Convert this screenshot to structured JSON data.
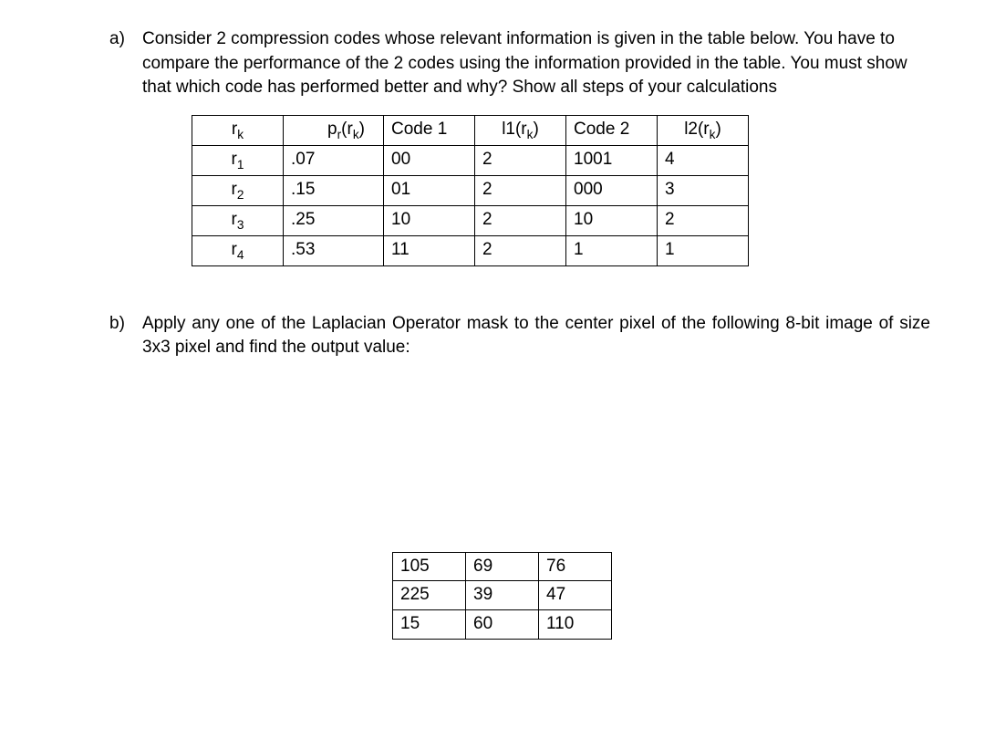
{
  "qa": {
    "label": "a)",
    "text": "Consider 2 compression codes whose relevant information is given in the table below. You have to compare the performance of the 2 codes using the information provided in the table. You must show that which code has performed better and why? Show all steps of your calculations"
  },
  "codes_table": {
    "headers": {
      "rk": "r",
      "rk_sub": "k",
      "pr": "p",
      "pr_sub": "r",
      "pr_arg": "(r",
      "pr_arg_sub": "k",
      "pr_close": ")",
      "code1": "Code 1",
      "l1": "l1(r",
      "l1_sub": "k",
      "l1_close": ")",
      "code2": "Code 2",
      "l2": "l2(r",
      "l2_sub": "k",
      "l2_close": ")"
    },
    "rows": [
      {
        "rk": "r",
        "rk_sub": "1",
        "pr": ".07",
        "c1": "00",
        "l1": "2",
        "c2": "1001",
        "l2": "4"
      },
      {
        "rk": "r",
        "rk_sub": "2",
        "pr": ".15",
        "c1": "01",
        "l1": "2",
        "c2": "000",
        "l2": "3"
      },
      {
        "rk": "r",
        "rk_sub": "3",
        "pr": ".25",
        "c1": "10",
        "l1": "2",
        "c2": "10",
        "l2": "2"
      },
      {
        "rk": "r",
        "rk_sub": "4",
        "pr": ".53",
        "c1": "11",
        "l1": "2",
        "c2": "1",
        "l2": "1"
      }
    ]
  },
  "qb": {
    "label": "b)",
    "text": "Apply any one of the Laplacian Operator mask to the center pixel of the following 8-bit image of size 3x3 pixel and find the output value:"
  },
  "image_matrix": [
    [
      "105",
      "69",
      "76"
    ],
    [
      "225",
      "39",
      "47"
    ],
    [
      "15",
      "60",
      "110"
    ]
  ],
  "chart_data": [
    {
      "type": "table",
      "title": "Compression codes comparison",
      "columns": [
        "r_k",
        "p_r(r_k)",
        "Code 1",
        "l1(r_k)",
        "Code 2",
        "l2(r_k)"
      ],
      "rows": [
        [
          "r_1",
          0.07,
          "00",
          2,
          "1001",
          4
        ],
        [
          "r_2",
          0.15,
          "01",
          2,
          "000",
          3
        ],
        [
          "r_3",
          0.25,
          "10",
          2,
          "10",
          2
        ],
        [
          "r_4",
          0.53,
          "11",
          2,
          "1",
          1
        ]
      ]
    },
    {
      "type": "table",
      "title": "3x3 8-bit image",
      "rows": [
        [
          105,
          69,
          76
        ],
        [
          225,
          39,
          47
        ],
        [
          15,
          60,
          110
        ]
      ]
    }
  ]
}
